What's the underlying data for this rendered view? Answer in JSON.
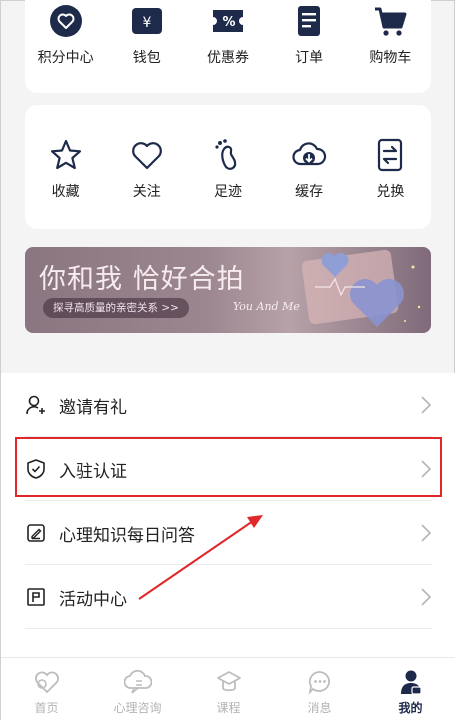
{
  "top_shortcuts": [
    {
      "label": "积分中心",
      "icon": "points-heart-icon"
    },
    {
      "label": "钱包",
      "icon": "wallet-icon"
    },
    {
      "label": "优惠券",
      "icon": "coupon-icon"
    },
    {
      "label": "订单",
      "icon": "order-icon"
    },
    {
      "label": "购物车",
      "icon": "cart-icon"
    }
  ],
  "mid_shortcuts": [
    {
      "label": "收藏",
      "icon": "star-icon"
    },
    {
      "label": "关注",
      "icon": "heart-icon"
    },
    {
      "label": "足迹",
      "icon": "footprint-icon"
    },
    {
      "label": "缓存",
      "icon": "cloud-download-icon"
    },
    {
      "label": "兑换",
      "icon": "exchange-icon"
    }
  ],
  "banner": {
    "title": "你和我 恰好合拍",
    "pill": "探寻高质量的亲密关系 >>",
    "subtitle": "You And Me"
  },
  "menu": [
    {
      "label": "邀请有礼",
      "icon": "invite-user-icon"
    },
    {
      "label": "入驻认证",
      "icon": "shield-check-icon"
    },
    {
      "label": "心理知识每日问答",
      "icon": "edit-note-icon"
    },
    {
      "label": "活动中心",
      "icon": "flag-icon"
    },
    {
      "label": "",
      "icon": "partial-item-icon"
    }
  ],
  "tabs": [
    {
      "label": "首页",
      "icon": "home-tab-icon",
      "active": false
    },
    {
      "label": "心理咨询",
      "icon": "consult-tab-icon",
      "active": false
    },
    {
      "label": "课程",
      "icon": "course-tab-icon",
      "active": false
    },
    {
      "label": "消息",
      "icon": "message-tab-icon",
      "active": false
    },
    {
      "label": "我的",
      "icon": "mine-tab-icon",
      "active": true
    }
  ],
  "colors": {
    "accent_dark": "#1e2a4a",
    "annotation_red": "#e0282a",
    "tab_inactive": "#b3b3b3"
  }
}
